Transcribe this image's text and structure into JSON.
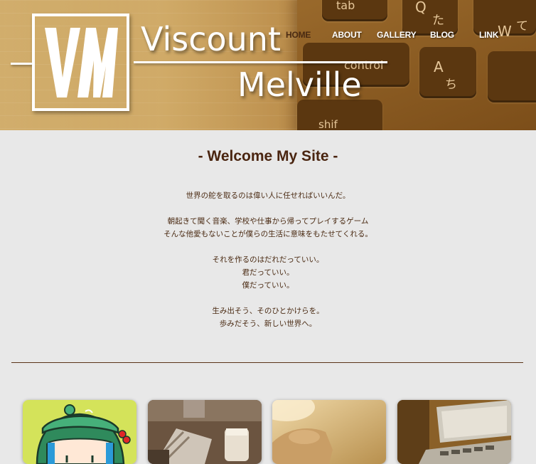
{
  "site": {
    "brand_top": "Viscount",
    "brand_bottom": "Melville",
    "logo_letters": "VM"
  },
  "nav": {
    "items": [
      {
        "label": "HOME",
        "active": true
      },
      {
        "label": "ABOUT",
        "active": false
      },
      {
        "label": "GALLERY",
        "active": false
      },
      {
        "label": "BLOG",
        "active": false
      },
      {
        "label": "LINK",
        "active": false
      }
    ]
  },
  "header_keys": {
    "tab": "tab",
    "q": "Q",
    "q_kana": "た",
    "w": "W",
    "w_kana": "て",
    "control": "control",
    "a": "A",
    "a_kana": "ち",
    "shift": "shif"
  },
  "main": {
    "heading": "- Welcome My Site -",
    "paragraphs": [
      [
        "世界の舵を取るのは偉い人に任せればいいんだ。"
      ],
      [
        "朝起きて聞く音楽、学校や仕事から帰ってプレイするゲーム",
        "そんな他愛もないことが僕らの生活に意味をもたせてくれる。"
      ],
      [
        "それを作るのはだれだっていい。",
        "君だっていい。",
        "僕だっていい。"
      ],
      [
        "生み出そう、そのひとかけらを。",
        "歩みだそう、新しい世界へ。"
      ]
    ]
  },
  "colors": {
    "accent_brown": "#4a2510",
    "page_bg": "#e8e8e8",
    "header_sepia": "#b88d45"
  },
  "cards": [
    {
      "icon": "anime-character-thumbnail"
    },
    {
      "icon": "desk-photo-thumbnail"
    },
    {
      "icon": "hand-photo-thumbnail"
    },
    {
      "icon": "laptop-photo-thumbnail"
    }
  ]
}
